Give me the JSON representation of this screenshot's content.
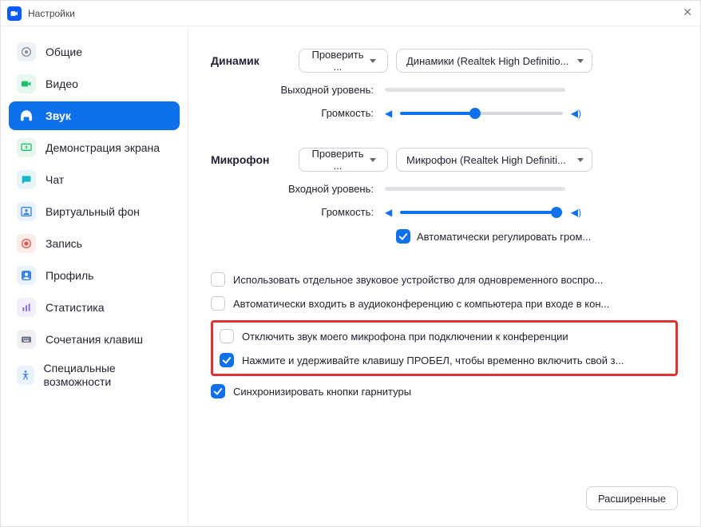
{
  "window": {
    "title": "Настройки"
  },
  "sidebar": {
    "items": [
      {
        "label": "Общие"
      },
      {
        "label": "Видео"
      },
      {
        "label": "Звук"
      },
      {
        "label": "Демонстрация экрана"
      },
      {
        "label": "Чат"
      },
      {
        "label": "Виртуальный фон"
      },
      {
        "label": "Запись"
      },
      {
        "label": "Профиль"
      },
      {
        "label": "Статистика"
      },
      {
        "label": "Сочетания клавиш"
      },
      {
        "label": "Специальные возможности"
      }
    ]
  },
  "speaker": {
    "title": "Динамик",
    "test_btn": "Проверить ...",
    "device": "Динамики (Realtek High Definitio...",
    "out_level_label": "Выходной уровень:",
    "volume_label": "Громкость:",
    "volume_pct": 46
  },
  "mic": {
    "title": "Микрофон",
    "test_btn": "Проверить ...",
    "device": "Микрофон (Realtek High Definiti...",
    "in_level_label": "Входной уровень:",
    "volume_label": "Громкость:",
    "volume_pct": 96,
    "auto_adjust": "Автоматически регулировать гром..."
  },
  "options": {
    "separate_device": "Использовать отдельное звуковое устройство для одновременного воспро...",
    "auto_join_audio": "Автоматически входить в аудиоконференцию с компьютера при входе в кон...",
    "mute_on_join": "Отключить звук моего микрофона при подключении к конференции",
    "push_to_talk": "Нажмите и удерживайте клавишу ПРОБЕЛ, чтобы временно включить свой з...",
    "sync_headset": "Синхронизировать кнопки гарнитуры"
  },
  "advanced_btn": "Расширенные"
}
